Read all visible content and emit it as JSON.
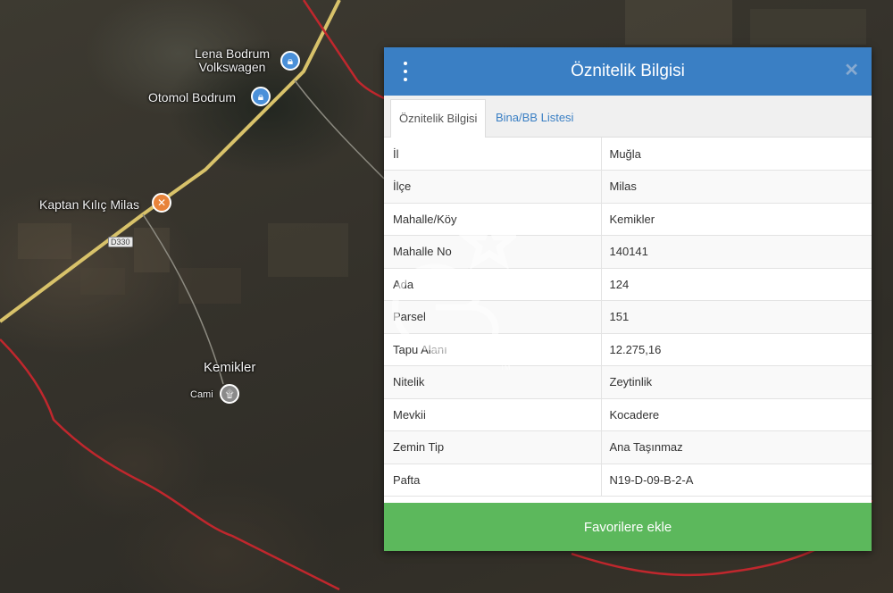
{
  "map": {
    "pois": [
      {
        "name": "Lena Bodrum\nVolkswagen",
        "icon": "lock-icon",
        "color": "#4a90d9"
      },
      {
        "name": "Otomol Bodrum",
        "icon": "lock-icon",
        "color": "#4a90d9"
      },
      {
        "name": "Kaptan Kılıç Milas",
        "icon": "restaurant-icon",
        "color": "#e8833a"
      },
      {
        "name": "Kemikler",
        "icon": "",
        "color": ""
      },
      {
        "name": "Cami",
        "icon": "mosque-icon",
        "color": "#8a8a8a"
      }
    ],
    "road_shield": "D330"
  },
  "panel": {
    "title": "Öznitelik Bilgisi",
    "close_glyph": "✕",
    "tabs": [
      {
        "label": "Öznitelik Bilgisi",
        "active": true
      },
      {
        "label": "Bina/BB Listesi",
        "active": false
      }
    ],
    "rows": [
      {
        "key": "İl",
        "value": "Muğla"
      },
      {
        "key": "İlçe",
        "value": "Milas"
      },
      {
        "key": "Mahalle/Köy",
        "value": "Kemikler"
      },
      {
        "key": "Mahalle No",
        "value": "140141"
      },
      {
        "key": "Ada",
        "value": "124"
      },
      {
        "key": "Parsel",
        "value": "151"
      },
      {
        "key": "Tapu Alanı",
        "value": "12.275,16"
      },
      {
        "key": "Nitelik",
        "value": "Zeytinlik"
      },
      {
        "key": "Mevkii",
        "value": "Kocadere"
      },
      {
        "key": "Zemin Tip",
        "value": "Ana Taşınmaz"
      },
      {
        "key": "Pafta",
        "value": "N19-D-09-B-2-A"
      }
    ],
    "favorite_button": "Favorilere ekle"
  },
  "watermark": {
    "text": "CB",
    "mark": "TM"
  },
  "colors": {
    "header": "#3a7fc4",
    "button": "#5cb85c",
    "boundary": "#c0272d"
  }
}
